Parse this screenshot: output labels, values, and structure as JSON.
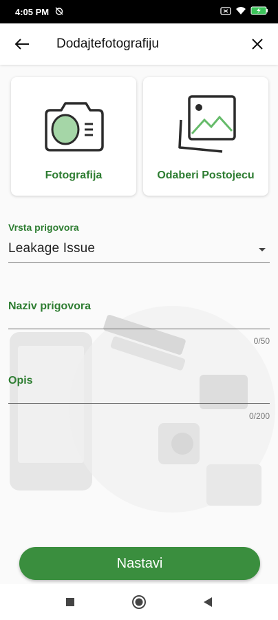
{
  "status_bar": {
    "time": "4:05 PM",
    "icons": [
      "alarm-off-icon",
      "screen-record-icon",
      "wifi-icon",
      "battery-charging-icon"
    ]
  },
  "app_bar": {
    "title": "Dodajtefotografiju",
    "back_icon": "arrow-left-icon",
    "close_icon": "close-icon"
  },
  "photo_options": [
    {
      "label": "Fotografija",
      "icon": "camera-icon"
    },
    {
      "label": "Odaberi Postojecu",
      "icon": "gallery-images-icon"
    }
  ],
  "form": {
    "type_label": "Vrsta prigovora",
    "type_value": "Leakage Issue",
    "name_label": "Naziv prigovora",
    "name_counter": "0/50",
    "desc_label": "Opis",
    "desc_counter": "0/200"
  },
  "primary_button": "Nastavi",
  "nav_bar": [
    "recents-square-icon",
    "home-circle-icon",
    "back-triangle-icon"
  ],
  "colors": {
    "accent": "#2e7d32",
    "button": "#3a8e3e",
    "status_bar": "#000000"
  }
}
